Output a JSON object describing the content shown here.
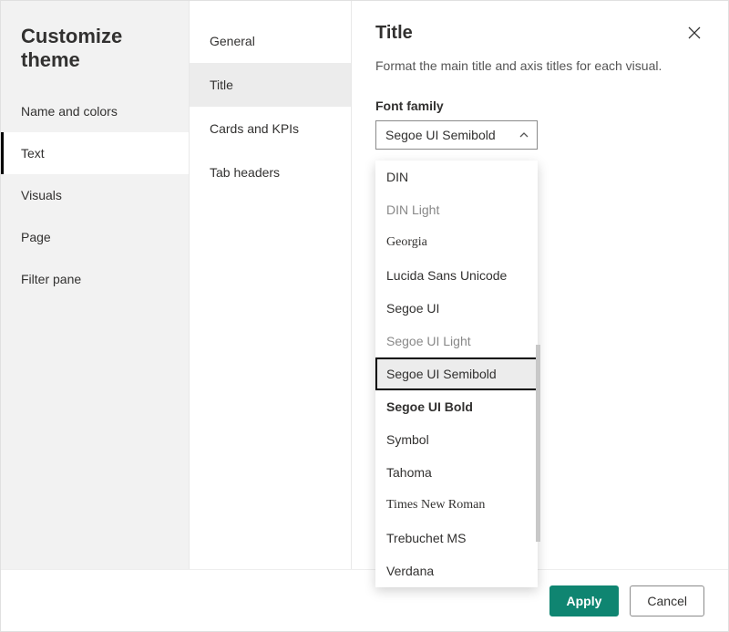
{
  "sidebar": {
    "title": "Customize theme",
    "items": [
      {
        "label": "Name and colors"
      },
      {
        "label": "Text"
      },
      {
        "label": "Visuals"
      },
      {
        "label": "Page"
      },
      {
        "label": "Filter pane"
      }
    ],
    "selected_index": 1
  },
  "subnav": {
    "items": [
      {
        "label": "General"
      },
      {
        "label": "Title"
      },
      {
        "label": "Cards and KPIs"
      },
      {
        "label": "Tab headers"
      }
    ],
    "selected_index": 1
  },
  "panel": {
    "title": "Title",
    "description": "Format the main title and axis titles for each visual.",
    "field_label": "Font family",
    "selected_font": "Segoe UI Semibold"
  },
  "font_options": [
    {
      "label": "DIN",
      "css": "font-family:Arial,sans-serif;"
    },
    {
      "label": "DIN Light",
      "css": "font-family:Arial,sans-serif;font-weight:300;color:#888;"
    },
    {
      "label": "Georgia",
      "css": "font-family:Georgia,serif;"
    },
    {
      "label": "Lucida Sans Unicode",
      "css": "font-family:'Lucida Sans Unicode',sans-serif;"
    },
    {
      "label": "Segoe UI",
      "css": "font-family:'Segoe UI',sans-serif;"
    },
    {
      "label": "Segoe UI Light",
      "css": "font-family:'Segoe UI',sans-serif;font-weight:300;color:#888;"
    },
    {
      "label": "Segoe UI Semibold",
      "css": "font-family:'Segoe UI',sans-serif;font-weight:500;"
    },
    {
      "label": "Segoe UI Bold",
      "css": "font-family:'Segoe UI',sans-serif;font-weight:700;"
    },
    {
      "label": "Symbol",
      "css": "font-family:'Segoe UI',sans-serif;"
    },
    {
      "label": "Tahoma",
      "css": "font-family:Tahoma,sans-serif;"
    },
    {
      "label": "Times New Roman",
      "css": "font-family:'Times New Roman',serif;"
    },
    {
      "label": "Trebuchet MS",
      "css": "font-family:'Trebuchet MS',sans-serif;"
    },
    {
      "label": "Verdana",
      "css": "font-family:Verdana,sans-serif;"
    }
  ],
  "footer": {
    "apply_label": "Apply",
    "cancel_label": "Cancel"
  }
}
